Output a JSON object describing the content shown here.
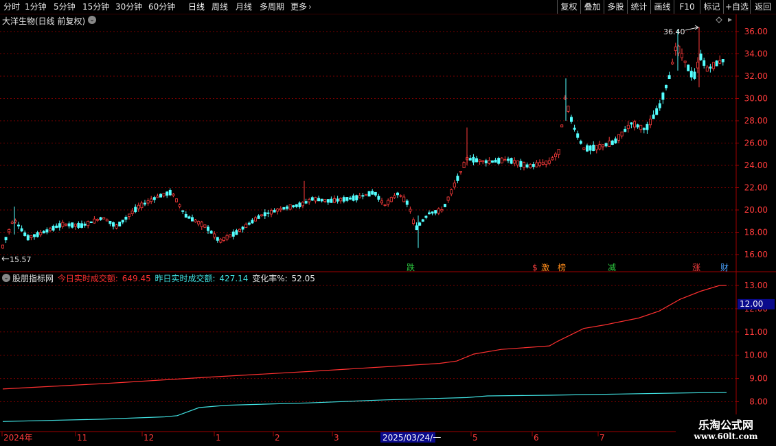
{
  "toolbar": {
    "periods": [
      "分时",
      "1分钟",
      "5分钟",
      "15分钟",
      "30分钟",
      "60分钟",
      "日线",
      "周线",
      "月线",
      "多周期",
      "更多"
    ],
    "active_period": "日线",
    "right_buttons": [
      "复权",
      "叠加",
      "多股",
      "统计",
      "画线",
      "F10",
      "标记",
      "+自选",
      "返回"
    ]
  },
  "main": {
    "stock_title": "大洋生物(日线 前复权)",
    "price_axis": [
      "36.00",
      "34.00",
      "32.00",
      "30.00",
      "28.00",
      "26.00",
      "24.00",
      "22.00",
      "20.00",
      "18.00",
      "16.00"
    ],
    "high_marker": "36.40",
    "low_marker": "15.57",
    "event_labels": [
      {
        "text": "跌",
        "color": "#2ecc40"
      },
      {
        "text": "$",
        "color": "#ff4040"
      },
      {
        "text": "激",
        "color": "#ff8c1a"
      },
      {
        "text": "榜",
        "color": "#ff8c1a"
      },
      {
        "text": "减",
        "color": "#2ecc40"
      },
      {
        "text": "涨",
        "color": "#ff4040"
      },
      {
        "text": "财",
        "color": "#4aa3ff"
      }
    ]
  },
  "indicator": {
    "name": "股朋指标网",
    "today_label": "今日实时成交额:",
    "today_value": "649.45",
    "yesterday_label": "昨日实时成交额:",
    "yesterday_value": "427.14",
    "change_label": "变化率%:",
    "change_value": "52.05",
    "axis": [
      "13.00",
      "12.00",
      "11.00",
      "10.00",
      "9.00",
      "8.00"
    ],
    "cursor_value": "12.00",
    "red_series_color": "#ff3030",
    "cyan_series_color": "#40e0e0"
  },
  "date_axis": {
    "labels": [
      "2024年",
      "11",
      "12",
      "1",
      "2",
      "3",
      "5",
      "6",
      "7"
    ],
    "highlight": "2025/03/24/一"
  },
  "watermark": {
    "title": "乐淘公式网",
    "url": "www.60lt.com"
  }
}
